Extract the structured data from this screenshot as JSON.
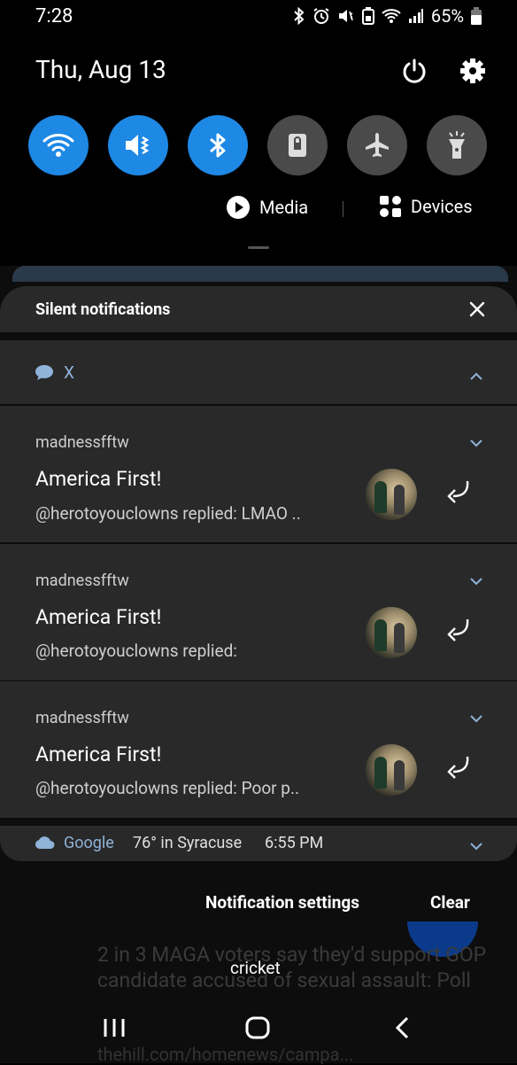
{
  "status_bar": {
    "time": "7:28",
    "battery": "65%"
  },
  "header": {
    "date": "Thu, Aug 13"
  },
  "quick_tiles": [
    {
      "name": "wifi",
      "on": true
    },
    {
      "name": "mute",
      "on": true
    },
    {
      "name": "bluetooth",
      "on": true
    },
    {
      "name": "screen-lock",
      "on": false
    },
    {
      "name": "airplane",
      "on": false
    },
    {
      "name": "flashlight",
      "on": false
    }
  ],
  "media_label": "Media",
  "devices_label": "Devices",
  "silent": {
    "title": "Silent notifications"
  },
  "x_group": {
    "label": "X"
  },
  "notifications": [
    {
      "app": "madnessfftw",
      "title": "America First!",
      "body": "@herotoyouclowns replied: LMAO .."
    },
    {
      "app": "madnessfftw",
      "title": "America First!",
      "body": "@herotoyouclowns replied:"
    },
    {
      "app": "madnessfftw",
      "title": "America First!",
      "body": "@herotoyouclowns replied: Poor p.."
    }
  ],
  "google": {
    "app": "Google",
    "weather": "76° in Syracuse",
    "time": "6:55 PM"
  },
  "footer": {
    "settings": "Notification settings",
    "clear": "Clear"
  },
  "behind": {
    "headline": "2 in 3 MAGA voters say they'd support GOP candidate accused of sexual assault: Poll",
    "url": "thehill.com/homenews/campa...",
    "overlay": "cricket"
  },
  "colors": {
    "accent": "#1e88e5",
    "card": "#292929",
    "link": "#8fb3d9"
  }
}
